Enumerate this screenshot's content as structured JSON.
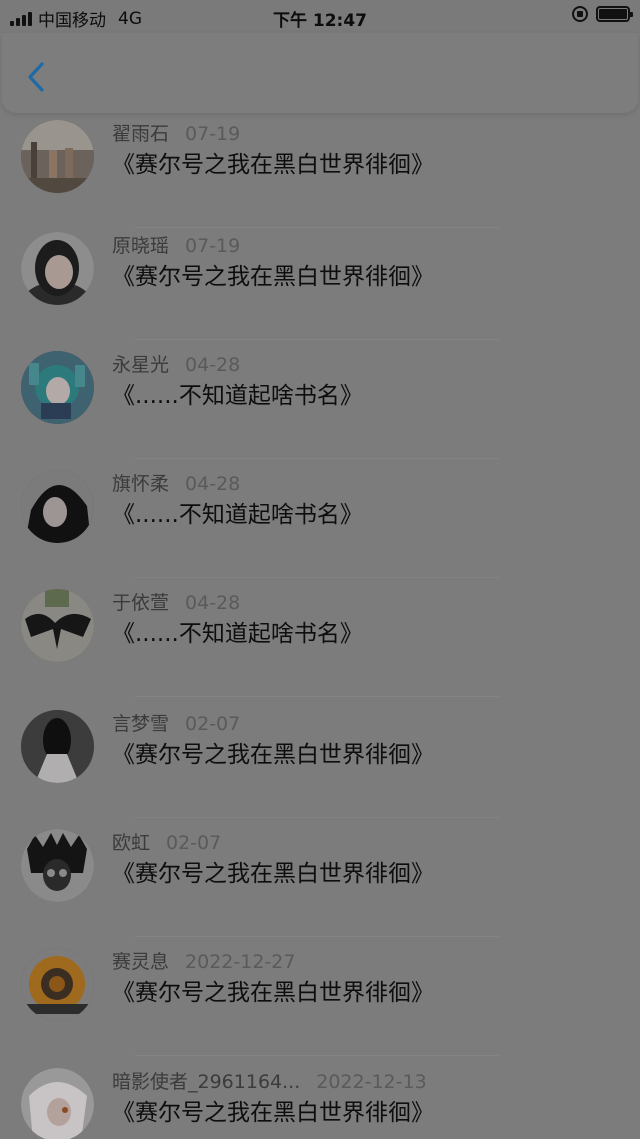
{
  "status_bar": {
    "carrier": "中国移动",
    "network": "4G",
    "time": "下午 12:47"
  },
  "nav": {
    "back_icon": "chevron-left-icon",
    "accent_color": "#1e6aa6"
  },
  "items": [
    {
      "username": "翟雨石",
      "date": "07-19",
      "title": "《赛尔号之我在黑白世界徘徊》"
    },
    {
      "username": "原晓瑶",
      "date": "07-19",
      "title": "《赛尔号之我在黑白世界徘徊》"
    },
    {
      "username": "永星光",
      "date": "04-28",
      "title": "《......不知道起啥书名》"
    },
    {
      "username": "旗怀柔",
      "date": "04-28",
      "title": "《......不知道起啥书名》"
    },
    {
      "username": "于依萱",
      "date": "04-28",
      "title": "《......不知道起啥书名》"
    },
    {
      "username": "言梦雪",
      "date": "02-07",
      "title": "《赛尔号之我在黑白世界徘徊》"
    },
    {
      "username": "欧虹",
      "date": "02-07",
      "title": "《赛尔号之我在黑白世界徘徊》"
    },
    {
      "username": "赛灵息",
      "date": "2022-12-27",
      "title": "《赛尔号之我在黑白世界徘徊》"
    },
    {
      "username": "暗影使者_2961164...",
      "date": "2022-12-13",
      "title": "《赛尔号之我在黑白世界徘徊》"
    }
  ]
}
